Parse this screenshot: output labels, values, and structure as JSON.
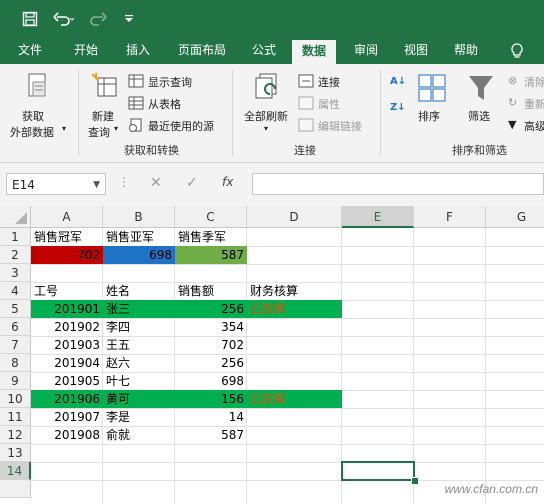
{
  "tabs": [
    "文件",
    "开始",
    "插入",
    "页面布局",
    "公式",
    "数据",
    "审阅",
    "视图",
    "帮助"
  ],
  "ribbon": {
    "get_external": [
      "获取",
      "外部数据"
    ],
    "new_query": [
      "新建",
      "查询"
    ],
    "show_query": "显示查询",
    "from_table": "从表格",
    "recent_sources": "最近使用的源",
    "group_get": "获取和转换",
    "refresh_all": "全部刷新",
    "connections": "连接",
    "properties": "属性",
    "edit_links": "编辑链接",
    "group_conn": "连接",
    "sort": "排序",
    "filter": "筛选",
    "clear": "清除",
    "reapply": "重新",
    "advanced": "高级",
    "group_sort": "排序和筛选"
  },
  "formula_bar": {
    "name_box": "E14",
    "fx": "fx",
    "content": ""
  },
  "columns": [
    "A",
    "B",
    "C",
    "D",
    "E",
    "F",
    "G"
  ],
  "rows": [
    "1",
    "2",
    "3",
    "4",
    "5",
    "6",
    "7",
    "8",
    "9",
    "10",
    "11",
    "12",
    "13",
    "14"
  ],
  "cells": {
    "r1": [
      "销售冠军",
      "销售亚军",
      "销售季军"
    ],
    "r2": [
      "702",
      "698",
      "587"
    ],
    "r4": [
      "工号",
      "姓名",
      "销售额",
      "财务核算"
    ],
    "data": [
      [
        "201901",
        "张三",
        "256",
        "已核算"
      ],
      [
        "201902",
        "李四",
        "354",
        ""
      ],
      [
        "201903",
        "王五",
        "702",
        ""
      ],
      [
        "201904",
        "赵六",
        "256",
        ""
      ],
      [
        "201905",
        "叶七",
        "698",
        ""
      ],
      [
        "201906",
        "黄可",
        "156",
        "已核算"
      ],
      [
        "201907",
        "李是",
        "14",
        ""
      ],
      [
        "201908",
        "俞就",
        "587",
        ""
      ]
    ]
  },
  "colors": {
    "excel_green": "#217346",
    "red": "#c00000",
    "blue": "#1f73c6",
    "green_fill": "#70ad47",
    "row_fill": "#00b050",
    "orange_text": "#c55a11"
  },
  "watermark": "www.cfan.com.cn"
}
